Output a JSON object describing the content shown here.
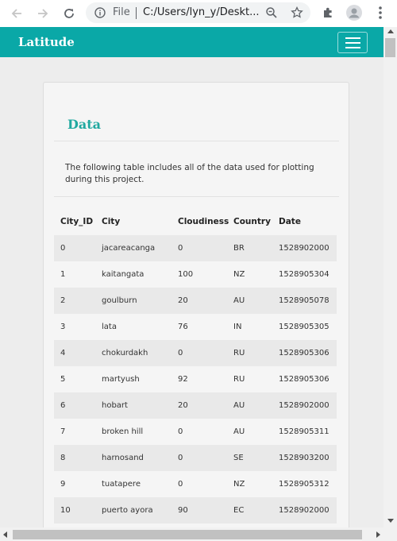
{
  "browser": {
    "protocol_label": "File",
    "url": "C:/Users/lyn_y/Deskt..."
  },
  "navbar": {
    "brand": "Latitude"
  },
  "card": {
    "title": "Data",
    "description": "The following table includes all of the data used for plotting during this project."
  },
  "table": {
    "headers": [
      "City_ID",
      "City",
      "Cloudiness",
      "Country",
      "Date"
    ],
    "rows": [
      [
        "0",
        "jacareacanga",
        "0",
        "BR",
        "1528902000"
      ],
      [
        "1",
        "kaitangata",
        "100",
        "NZ",
        "1528905304"
      ],
      [
        "2",
        "goulburn",
        "20",
        "AU",
        "1528905078"
      ],
      [
        "3",
        "lata",
        "76",
        "IN",
        "1528905305"
      ],
      [
        "4",
        "chokurdakh",
        "0",
        "RU",
        "1528905306"
      ],
      [
        "5",
        "martyush",
        "92",
        "RU",
        "1528905306"
      ],
      [
        "6",
        "hobart",
        "20",
        "AU",
        "1528902000"
      ],
      [
        "7",
        "broken hill",
        "0",
        "AU",
        "1528905311"
      ],
      [
        "8",
        "harnosand",
        "0",
        "SE",
        "1528903200"
      ],
      [
        "9",
        "tuatapere",
        "0",
        "NZ",
        "1528905312"
      ],
      [
        "10",
        "puerto ayora",
        "90",
        "EC",
        "1528902000"
      ]
    ]
  },
  "colors": {
    "navbar": "#0aa8a7",
    "title": "#21a9a0",
    "stripe": "#e9e9e9"
  }
}
